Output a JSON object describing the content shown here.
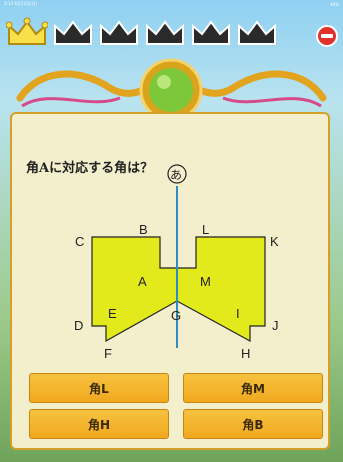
{
  "statusbar": {
    "time": "3:13  4月12日(日)",
    "battery": "40%"
  },
  "question": "角Aに対応する角は？",
  "figure": {
    "marker": "あ",
    "labels": {
      "A": "A",
      "B": "B",
      "C": "C",
      "D": "D",
      "E": "E",
      "F": "F",
      "G": "G",
      "H": "H",
      "I": "I",
      "J": "J",
      "K": "K",
      "L": "L",
      "M": "M"
    },
    "fill_color": "#e3ea1c",
    "axis_color": "#2b8fc4"
  },
  "answers": [
    "角L",
    "角M",
    "角H",
    "角B"
  ],
  "colors": {
    "button": "#f3b42c",
    "panel": "#f3efcc",
    "stop": "#e0312b"
  }
}
